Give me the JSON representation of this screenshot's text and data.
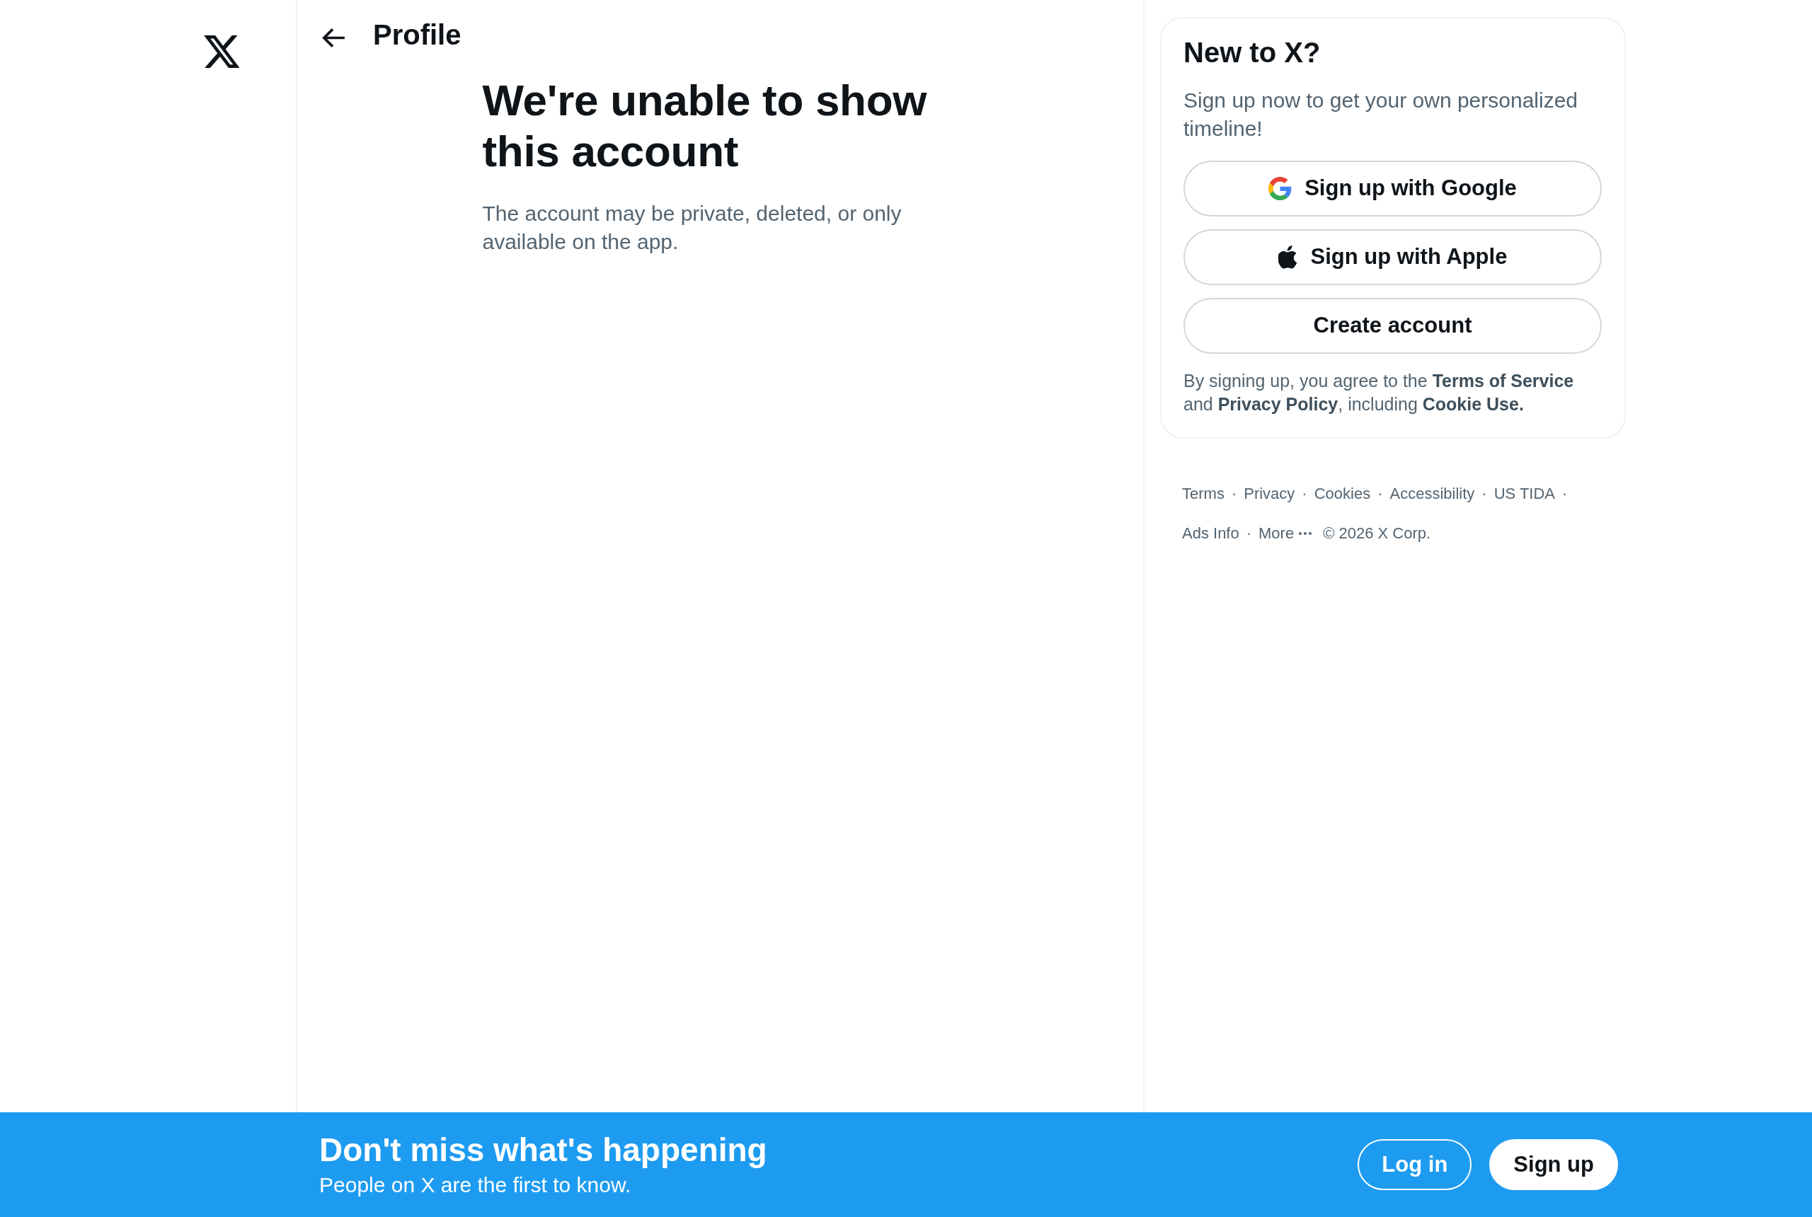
{
  "header": {
    "title": "Profile"
  },
  "empty_state": {
    "title": "We're unable to show this account",
    "message": "The account may be private, deleted, or only available on the app."
  },
  "signup_card": {
    "title": "New to X?",
    "subtitle": "Sign up now to get your own personalized timeline!",
    "buttons": [
      {
        "kind": "google",
        "label": "Sign up with Google"
      },
      {
        "kind": "apple",
        "label": "Sign up with Apple"
      },
      {
        "kind": "plain",
        "label": "Create account"
      }
    ],
    "legal": "By signing up, you agree to the **Terms of Service** and **Privacy Policy**, including **Cookie Use.**"
  },
  "footer": {
    "separator": "·",
    "links": [
      {
        "kind": "link",
        "text": "Terms"
      },
      {
        "kind": "link",
        "text": "Privacy"
      },
      {
        "kind": "link",
        "text": "Cookies"
      },
      {
        "kind": "link",
        "text": "Accessibility"
      },
      {
        "kind": "link",
        "text": "US TIDA"
      },
      {
        "kind": "link",
        "text": "Ads Info"
      },
      {
        "kind": "menu",
        "text": "More"
      },
      {
        "kind": "copyright",
        "text": "© 2026 X Corp."
      }
    ]
  },
  "bottom_bar": {
    "title": "Don't miss what's happening",
    "subtitle": "People on X are the first to know.",
    "buttons": [
      {
        "kind": "outline",
        "label": "Log in"
      },
      {
        "kind": "filled",
        "label": "Sign up"
      }
    ]
  }
}
